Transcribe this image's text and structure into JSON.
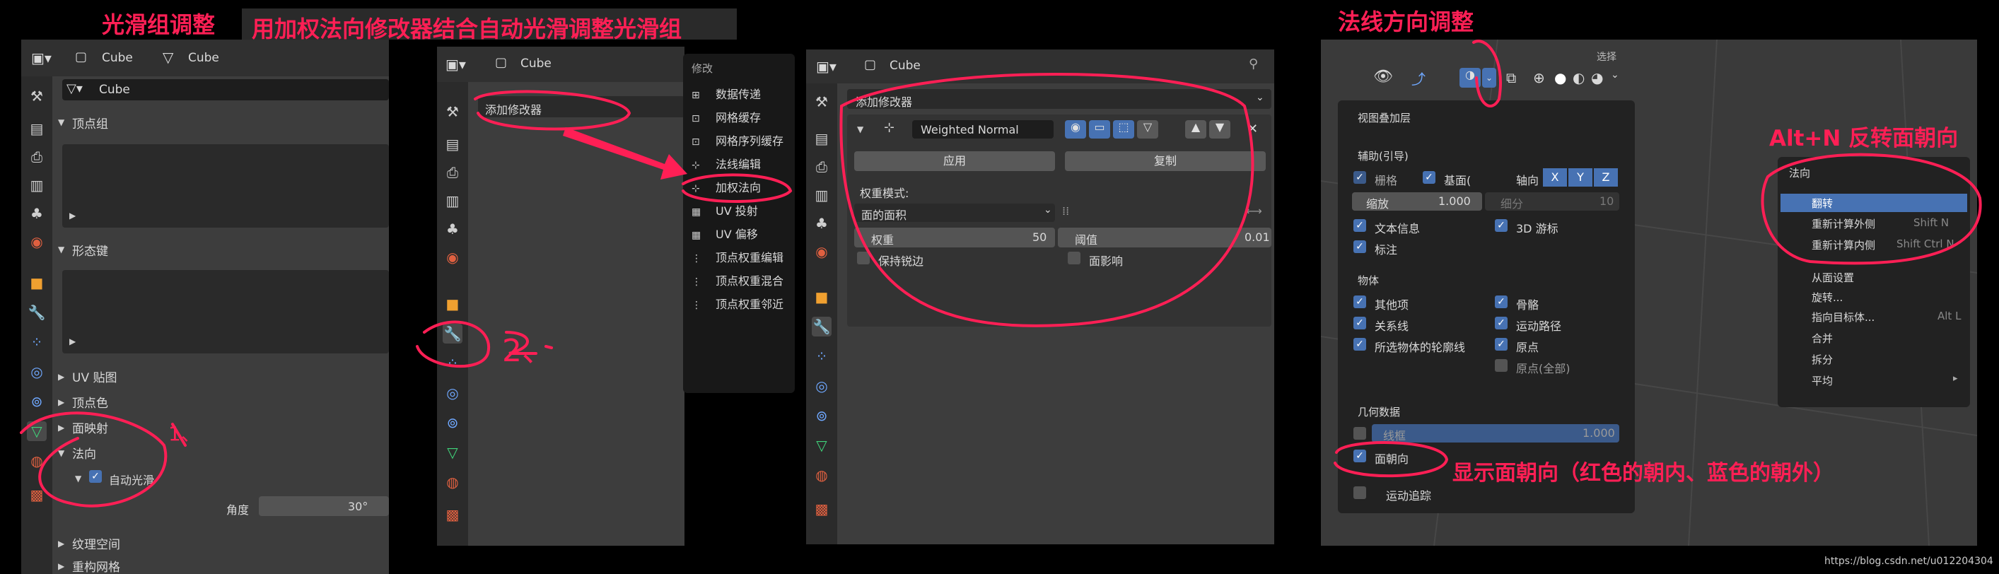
{
  "titles": {
    "smooth_group": "光滑组调整",
    "weighted_normal_tip": "用加权法向修改器结合自动光滑调整光滑组",
    "normal_direction": "法线方向调整",
    "flip_shortcut": "Alt+N 反转面朝向",
    "show_face_orientation": "显示面朝向（红色的朝内、蓝色的朝外）",
    "step_1": "1、",
    "step_2": "2、"
  },
  "panel1": {
    "header_object": "Cube",
    "header_mesh": "Cube",
    "mesh_name": "Cube",
    "sections": {
      "vertex_groups": "顶点组",
      "shape_keys": "形态键",
      "uv_maps": "UV 贴图",
      "vertex_colors": "顶点色",
      "face_maps": "面映射",
      "normals": "法向",
      "auto_smooth": "自动光滑",
      "angle_label": "角度",
      "angle_value": "30°",
      "texture_space": "纹理空间",
      "remesh": "重构网格"
    }
  },
  "panel2": {
    "header_object": "Cube",
    "add_modifier": "添加修改器"
  },
  "modifier_menu": {
    "title": "修改",
    "items": [
      "数据传递",
      "网格缓存",
      "网格序列缓存",
      "法线编辑",
      "加权法向",
      "UV 投射",
      "UV 偏移",
      "顶点权重编辑",
      "顶点权重混合",
      "顶点权重邻近"
    ],
    "icons": [
      "data-transfer-icon",
      "mesh-cache-icon",
      "mesh-sequence-cache-icon",
      "normal-edit-icon",
      "weighted-normal-icon",
      "uv-project-icon",
      "uv-warp-icon",
      "vertex-weight-edit-icon",
      "vertex-weight-mix-icon",
      "vertex-weight-proximity-icon"
    ]
  },
  "panel3": {
    "header_object": "Cube",
    "add_modifier": "添加修改器",
    "modifier_name": "Weighted Normal",
    "apply": "应用",
    "copy": "复制",
    "weight_mode_label": "权重模式:",
    "weight_mode_value": "面的面积",
    "weight_label": "权重",
    "weight_value": "50",
    "threshold_label": "阈值",
    "threshold_value": "0.01",
    "keep_sharp": "保持锐边",
    "face_influence": "面影响"
  },
  "overlay": {
    "corner_label": "选择",
    "title": "视图叠加层",
    "guides_header": "辅助(引导)",
    "grid": "栅格",
    "floor": "基面(",
    "axis": "轴向",
    "axes": [
      "X",
      "Y",
      "Z"
    ],
    "scale_label": "缩放",
    "scale_value": "1.000",
    "subdiv_label": "细分",
    "subdiv_value": "10",
    "text_info": "文本信息",
    "cursor_3d": "3D 游标",
    "annotations": "标注",
    "objects_header": "物体",
    "extras": "其他项",
    "bones": "骨骼",
    "relationships": "关系线",
    "motion_paths": "运动路径",
    "outline_selected": "所选物体的轮廓线",
    "origins": "原点",
    "origins_all": "原点(全部)",
    "geometry_header": "几何数据",
    "wireframe": "线框",
    "wireframe_value": "1.000",
    "face_orientation": "面朝向",
    "motion_tracking": "运动追踪"
  },
  "normal_menu": {
    "title": "法向",
    "items": [
      {
        "label": "翻转",
        "shortcut": ""
      },
      {
        "label": "重新计算外侧",
        "shortcut": "Shift N"
      },
      {
        "label": "重新计算内侧",
        "shortcut": "Shift Ctrl N"
      },
      {
        "label": "从面设置",
        "shortcut": ""
      },
      {
        "label": "旋转...",
        "shortcut": ""
      },
      {
        "label": "指向目标体...",
        "shortcut": "Alt L"
      },
      {
        "label": "合并",
        "shortcut": ""
      },
      {
        "label": "拆分",
        "shortcut": ""
      },
      {
        "label": "平均",
        "shortcut": "▸"
      }
    ]
  },
  "watermark": "https://blog.csdn.net/u012204304",
  "colors": {
    "accent": "#4772b3",
    "annotation": "#ff1f55",
    "panel": "#3d3d3d",
    "menu": "#181818"
  }
}
